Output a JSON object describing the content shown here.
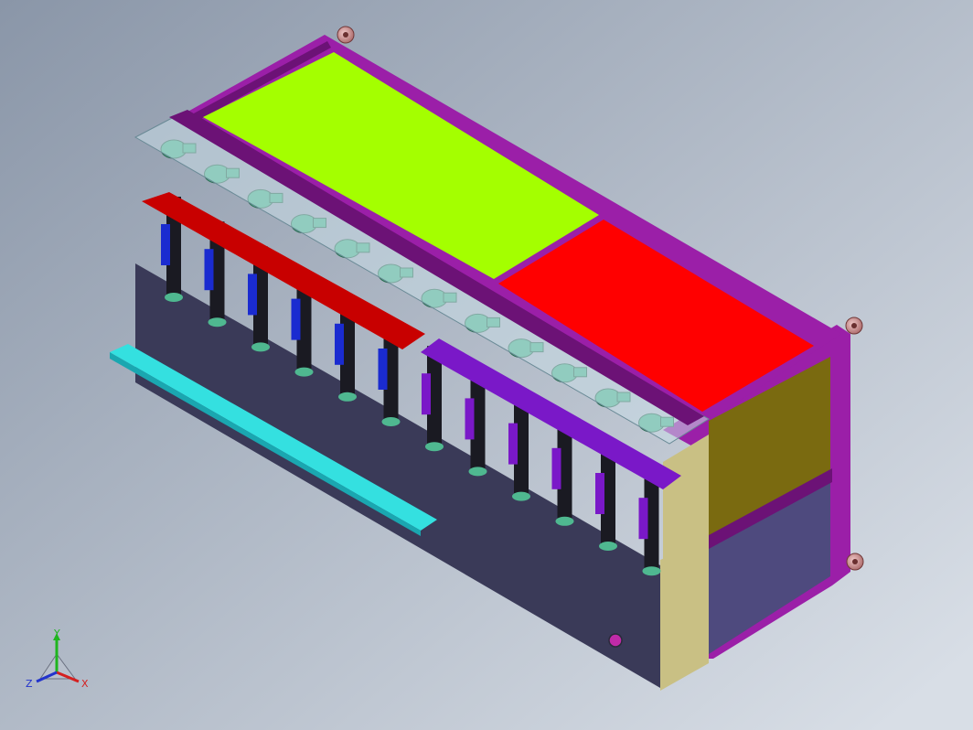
{
  "triad": {
    "y_label": "Y",
    "z_label": "Z",
    "x_label": "X",
    "y_color": "#1fb51f",
    "z_color": "#2233cc",
    "x_color": "#d42020"
  },
  "colors": {
    "background_light": "#d8dee6",
    "background_dark": "#8a96a8",
    "frame": "#9b1fa8",
    "frame_dark": "#6c1276",
    "top_green_panel": "#a4ff00",
    "top_red_panel": "#ff0000",
    "side_olive_panel": "#7a6a10",
    "side_lavender_panel": "#4e4a7e",
    "front_panel": "#3a3a58",
    "front_left_strip": "#c9c084",
    "cyan_tray": "#34e0e0",
    "red_rail": "#c80000",
    "purple_rail": "#7a18c8",
    "module_green": "#4fb890",
    "glass": "#c8dde6"
  },
  "components": {
    "module_count": 12,
    "caster_count": 3
  }
}
